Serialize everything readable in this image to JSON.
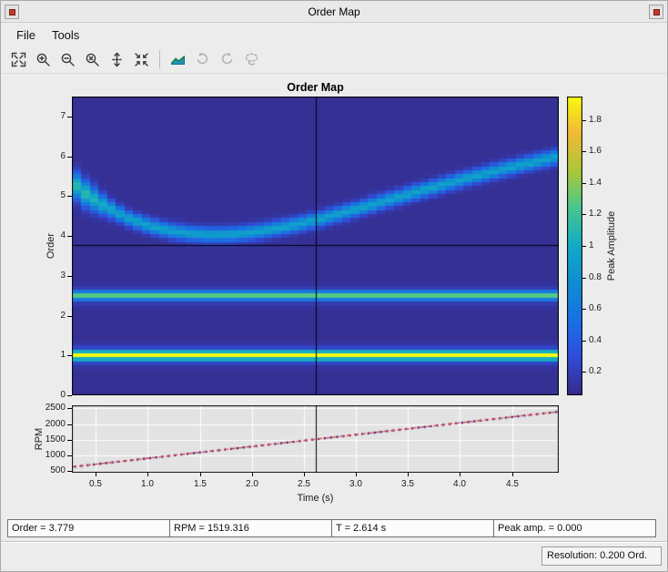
{
  "window": {
    "title": "Order Map"
  },
  "menu": {
    "items": [
      {
        "label": "File"
      },
      {
        "label": "Tools"
      }
    ]
  },
  "toolbar": {
    "icons": [
      {
        "name": "expand-axes-icon",
        "glyph": "expand",
        "enabled": true
      },
      {
        "name": "zoom-in-icon",
        "glyph": "zoom-in",
        "enabled": true
      },
      {
        "name": "zoom-out-icon",
        "glyph": "zoom-out",
        "enabled": true
      },
      {
        "name": "zoom-x-icon",
        "glyph": "zoom-x",
        "enabled": true
      },
      {
        "name": "pan-y-icon",
        "glyph": "pan-y",
        "enabled": true
      },
      {
        "name": "reset-view-icon",
        "glyph": "reset",
        "enabled": true
      },
      {
        "name": "surface-map-icon",
        "glyph": "surface",
        "enabled": true
      },
      {
        "name": "rotate-ccw-icon",
        "glyph": "rot-ccw",
        "enabled": false
      },
      {
        "name": "rotate-cw-icon",
        "glyph": "rot-cw",
        "enabled": false
      },
      {
        "name": "lasso-select-icon",
        "glyph": "lasso",
        "enabled": false
      }
    ]
  },
  "figure": {
    "title": "Order Map",
    "order_axis_label": "Order",
    "rpm_axis_label": "RPM",
    "time_axis_label": "Time (s)",
    "colorbar_label": "Peak Amplitude"
  },
  "readouts": [
    {
      "name": "order-readout",
      "text": "Order = 3.779"
    },
    {
      "name": "rpm-readout",
      "text": "RPM = 1519.316"
    },
    {
      "name": "time-readout",
      "text": "T = 2.614 s"
    },
    {
      "name": "peak-readout",
      "text": "Peak amp. = 0.000"
    }
  ],
  "statusbar": {
    "resolution": "Resolution: 0.200 Ord."
  },
  "chart_data": [
    {
      "type": "heatmap",
      "title": "Order Map",
      "xlabel": "Time (s)",
      "ylabel": "Order",
      "xlim": [
        0.27,
        4.95
      ],
      "ylim": [
        0,
        7.5
      ],
      "yticks": [
        0,
        1,
        2,
        3,
        4,
        5,
        6,
        7
      ],
      "colormap": "parula",
      "colorbar": {
        "label": "Peak Amplitude",
        "ticks": [
          0.2,
          0.4,
          0.6,
          0.8,
          1,
          1.2,
          1.4,
          1.6,
          1.8
        ],
        "range": [
          0.05,
          1.95
        ]
      },
      "background_amplitude": 0.09,
      "order_bands": [
        {
          "order": 1,
          "peak_amplitude": 1.85,
          "width_sigma": 0.07
        },
        {
          "order": 2.5,
          "peak_amplitude": 1.0,
          "width_sigma": 0.07
        }
      ],
      "resonance_ridge": {
        "peak_amplitude": 0.85,
        "width_sigma": 0.12,
        "points": [
          [
            0.27,
            5.35
          ],
          [
            0.4,
            5.05
          ],
          [
            0.6,
            4.72
          ],
          [
            0.8,
            4.45
          ],
          [
            1.0,
            4.26
          ],
          [
            1.2,
            4.13
          ],
          [
            1.4,
            4.06
          ],
          [
            1.6,
            4.03
          ],
          [
            1.8,
            4.04
          ],
          [
            2.0,
            4.09
          ],
          [
            2.2,
            4.17
          ],
          [
            2.4,
            4.27
          ],
          [
            2.6,
            4.39
          ],
          [
            2.8,
            4.53
          ],
          [
            3.0,
            4.67
          ],
          [
            3.2,
            4.82
          ],
          [
            3.4,
            4.97
          ],
          [
            3.6,
            5.12
          ],
          [
            3.8,
            5.26
          ],
          [
            4.0,
            5.4
          ],
          [
            4.2,
            5.54
          ],
          [
            4.4,
            5.67
          ],
          [
            4.6,
            5.79
          ],
          [
            4.8,
            5.91
          ],
          [
            4.95,
            6.0
          ]
        ]
      },
      "cursor": {
        "time": 2.614,
        "order": 3.779,
        "peak_amplitude": 0.0
      }
    },
    {
      "type": "line",
      "xlabel": "Time (s)",
      "ylabel": "RPM",
      "xlim": [
        0.27,
        4.95
      ],
      "ylim": [
        450,
        2600
      ],
      "xticks": [
        0.5,
        1.0,
        1.5,
        2.0,
        2.5,
        3.0,
        3.5,
        4.0,
        4.5
      ],
      "yticks": [
        500,
        1000,
        1500,
        2000,
        2500
      ],
      "grid": true,
      "series": [
        {
          "name": "rpm-profile",
          "style": "dashed-with-markers",
          "color": "#e0393e",
          "marker_color": "#1a1a8c",
          "points": [
            [
              0.27,
              636
            ],
            [
              2.614,
              1519.316
            ],
            [
              4.95,
              2400
            ]
          ]
        }
      ],
      "cursor": {
        "time": 2.614
      }
    }
  ]
}
